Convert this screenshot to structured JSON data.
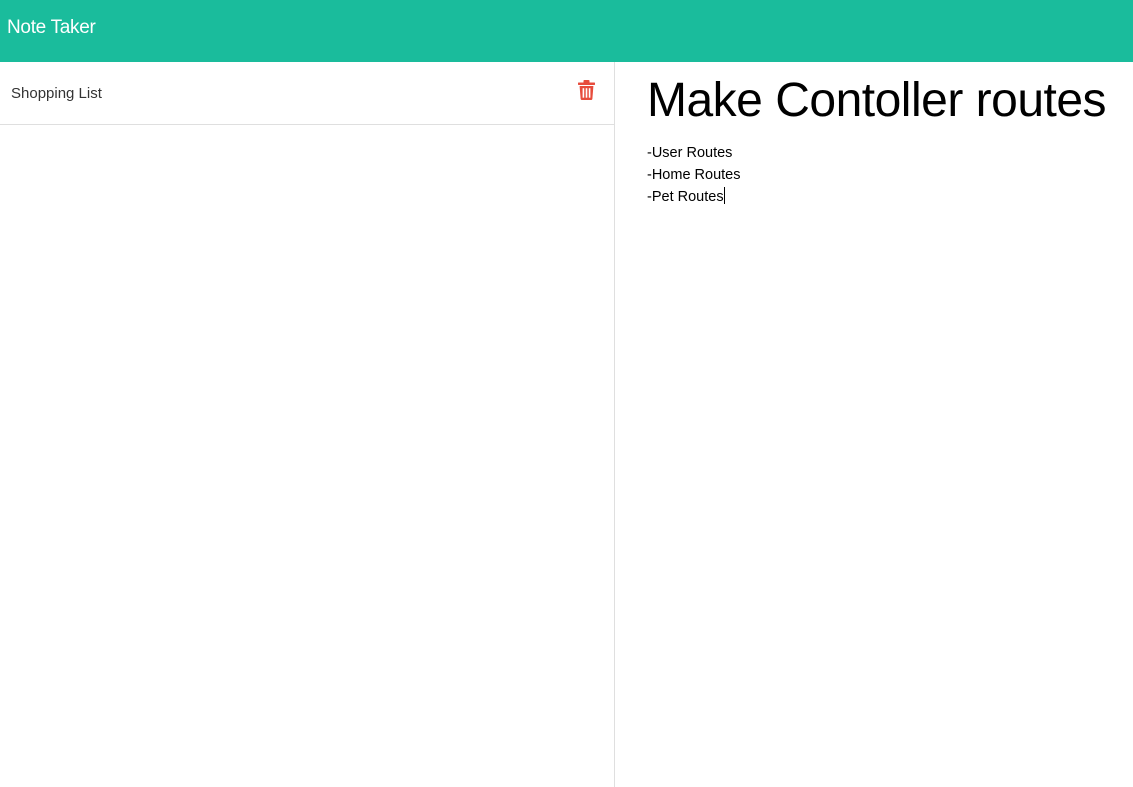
{
  "navbar": {
    "brand": "Note Taker",
    "background_color": "#1abc9c"
  },
  "sidebar": {
    "notes": [
      {
        "title": "Shopping List",
        "delete_icon": "trash-icon"
      }
    ],
    "delete_icon_color": "#e74c3c"
  },
  "editor": {
    "title": "Make Contoller routes",
    "body": "-User Routes\n-Home Routes\n-Pet Routes"
  }
}
